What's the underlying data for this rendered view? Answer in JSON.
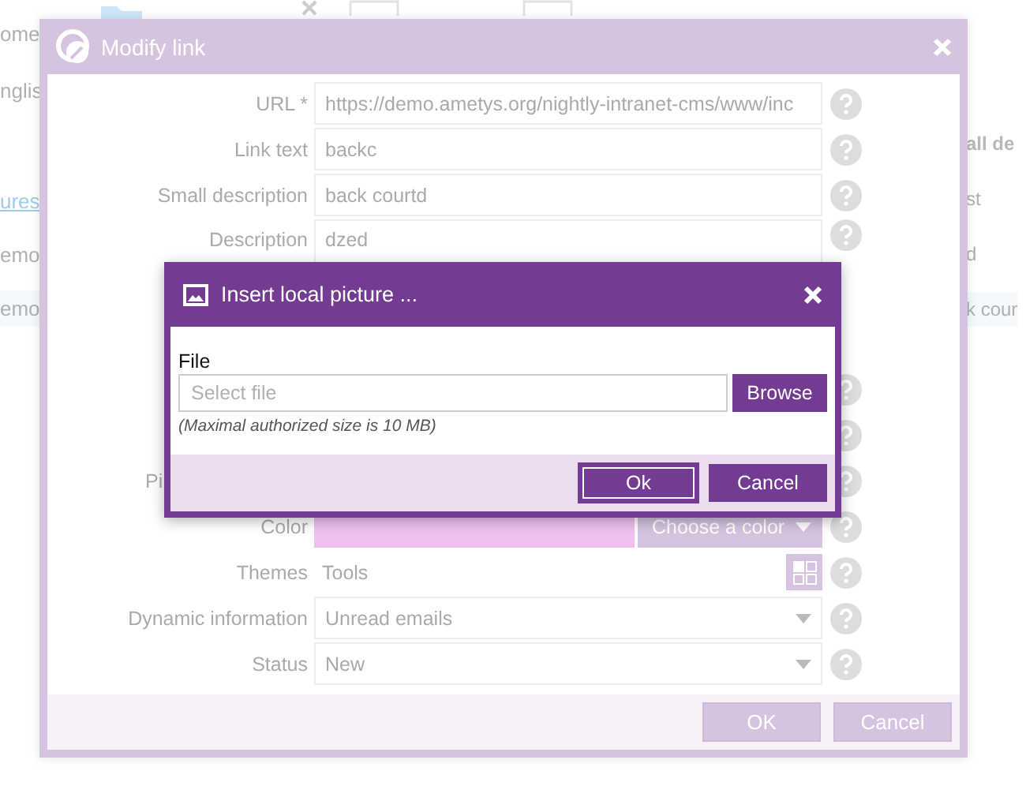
{
  "background": {
    "left_texts": [
      {
        "kind": "tab",
        "text": "ome"
      },
      {
        "kind": "field",
        "text": "nglis"
      },
      {
        "kind": "link",
        "text": "ures"
      },
      {
        "kind": "cell",
        "text": "emo"
      },
      {
        "kind": "selected",
        "text": "emo"
      }
    ],
    "right_texts": [
      {
        "kind": "header",
        "text": "all de"
      },
      {
        "kind": "cell",
        "text": "st"
      },
      {
        "kind": "cell",
        "text": "d"
      },
      {
        "kind": "selected",
        "text": "k cour"
      }
    ]
  },
  "dialog": {
    "title": "Modify link",
    "fields": [
      {
        "kind": "text",
        "label": "URL *",
        "value": "https://demo.ametys.org/nightly-intranet-cms/www/inc"
      },
      {
        "kind": "text",
        "label": "Link text",
        "value": "backc"
      },
      {
        "kind": "text",
        "label": "Small description",
        "value": "back courtd"
      },
      {
        "kind": "textarea",
        "label": "Description",
        "value": "dzed"
      },
      {
        "kind": "covered"
      },
      {
        "kind": "covered"
      },
      {
        "kind": "covered",
        "label": "Pi"
      },
      {
        "kind": "color",
        "label": "Color",
        "color": "#f0c0ee",
        "button": "Choose a color"
      },
      {
        "kind": "tags",
        "label": "Themes",
        "value": "Tools"
      },
      {
        "kind": "select",
        "label": "Dynamic information",
        "value": "Unread emails"
      },
      {
        "kind": "select",
        "label": "Status",
        "value": "New"
      }
    ],
    "buttons": [
      "OK",
      "Cancel"
    ]
  },
  "picture_dialog": {
    "title": "Insert local picture ...",
    "file_label": "File",
    "placeholder": "Select file",
    "browse": "Browse",
    "note": "(Maximal authorized size is 10 MB)",
    "buttons": [
      {
        "label": "Ok",
        "selected": true
      },
      {
        "label": "Cancel",
        "selected": false
      }
    ]
  }
}
